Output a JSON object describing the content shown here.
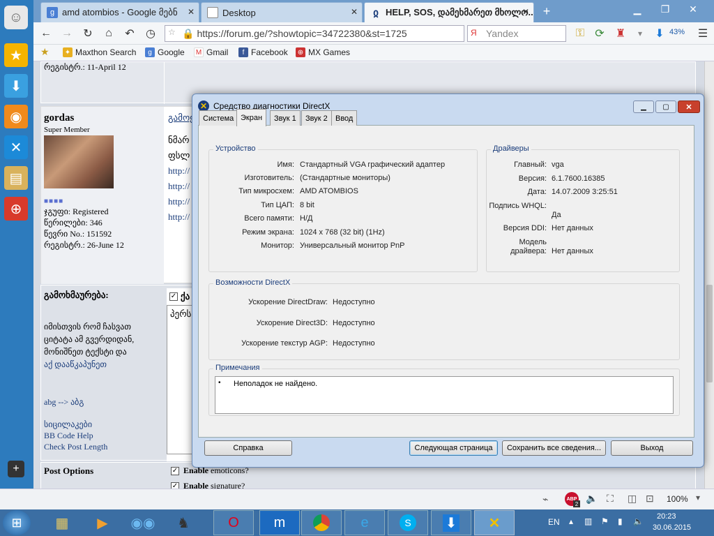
{
  "browser": {
    "tabs": [
      {
        "label": "amd atombios - Google მებნ"
      },
      {
        "label": "Desktop"
      },
      {
        "label": "HELP, SOS, დამეხმარეთ მხოლო..."
      }
    ],
    "new_tab": "+",
    "url": "https://forum.ge/?showtopic=34722380&st=1725",
    "search_placeholder": "Yandex",
    "download_percent": "43%",
    "bookmarks": [
      "Maxthon Search",
      "Google",
      "Gmail",
      "Facebook",
      "MX Games"
    ]
  },
  "forum": {
    "prev_user": {
      "registered": "რეგისტრ.: 11-April 12"
    },
    "user": {
      "name": "gordas",
      "rank": "Super Member",
      "group": "ჯგუფი: Registered",
      "posts": "წერილები: 346",
      "member_no": "წევრი No.: 151592",
      "registered": "რეგისტრ.: 26-June 12"
    },
    "post_title": "გამოყ",
    "post_text": "ნმარ",
    "post_text2": "ფსლ",
    "links": [
      "http://",
      "http://",
      "http://",
      "http://"
    ],
    "reply": {
      "heading": "გამოხმაურება:",
      "hint_line1": "იმისთვის რომ ჩასვათ",
      "hint_line2": "ციტატა ამ გვერდიდან,",
      "hint_line3": "მონიშნეთ ტექსტი და",
      "hint_link": "აქ დააწკაპუნეთ",
      "translit": "abg --> აბგ",
      "smilies": "სიცილაკები",
      "bbcode": "BB Code Help",
      "check_length": "Check Post Length",
      "checkbox_label": "ქა",
      "textarea_text": "პერს"
    },
    "post_options": {
      "heading": "Post Options",
      "opt1_bold": "Enable",
      "opt1": "emoticons?",
      "opt2_bold": "Enable",
      "opt2": "signature?"
    }
  },
  "statusbar": {
    "zoom": "100%",
    "abp_count": "2"
  },
  "taskbar": {
    "lang": "EN",
    "time": "20:23",
    "date": "30.06.2015"
  },
  "dialog": {
    "title": "Средство диагностики DirectX",
    "tabs": [
      "Система",
      "Экран",
      "Звук 1",
      "Звук 2",
      "Ввод"
    ],
    "active_tab": "Экран",
    "device": {
      "title": "Устройство",
      "rows": [
        {
          "label": "Имя:",
          "value": "Стандартный VGA графический адаптер"
        },
        {
          "label": "Изготовитель:",
          "value": "(Стандартные мониторы)"
        },
        {
          "label": "Тип микросхем:",
          "value": "AMD ATOMBIOS"
        },
        {
          "label": "Тип ЦАП:",
          "value": "8 bit"
        },
        {
          "label": "Всего памяти:",
          "value": "Н/Д"
        },
        {
          "label": "Режим экрана:",
          "value": "1024 x 768 (32 bit) (1Hz)"
        },
        {
          "label": "Монитор:",
          "value": "Универсальный монитор PnP"
        }
      ]
    },
    "drivers": {
      "title": "Драйверы",
      "rows": [
        {
          "label": "Главный:",
          "value": "vga"
        },
        {
          "label": "Версия:",
          "value": "6.1.7600.16385"
        },
        {
          "label": "Дата:",
          "value": "14.07.2009 3:25:51"
        },
        {
          "label": "Подпись WHQL:",
          "value": "Да"
        },
        {
          "label": "Версия DDI:",
          "value": "Нет данных"
        },
        {
          "label": "Модель",
          "label2": "драйвера:",
          "value": "Нет данных"
        }
      ]
    },
    "features": {
      "title": "Возможности DirectX",
      "rows": [
        {
          "label": "Ускорение DirectDraw:",
          "value": "Недоступно"
        },
        {
          "label": "Ускорение Direct3D:",
          "value": "Недоступно"
        },
        {
          "label": "Ускорение текстур AGP:",
          "value": "Недоступно"
        }
      ]
    },
    "notes": {
      "title": "Примечания",
      "text": "Неполадок не найдено."
    },
    "buttons": {
      "help": "Справка",
      "next": "Следующая страница",
      "save": "Сохранить все сведения...",
      "exit": "Выход"
    }
  }
}
